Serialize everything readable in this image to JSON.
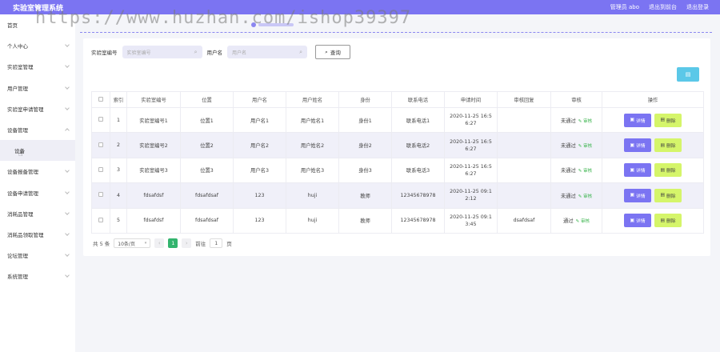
{
  "app": {
    "title": "实验室管理系统",
    "watermark": "https://www.huzhan.com/ishop39397"
  },
  "topbar": {
    "user": "管理员 abo",
    "back_to_front": "退出到前台",
    "logout": "退出登录"
  },
  "sidebar": {
    "items": [
      {
        "label": "首页"
      },
      {
        "label": "个人中心"
      },
      {
        "label": "实验室管理"
      },
      {
        "label": "用户管理"
      },
      {
        "label": "实验室申请管理"
      },
      {
        "label": "设备管理"
      },
      {
        "label": "设备"
      },
      {
        "label": "设备报备管理"
      },
      {
        "label": "设备申请管理"
      },
      {
        "label": "消耗品管理"
      },
      {
        "label": "消耗品领取管理"
      },
      {
        "label": "论坛管理"
      },
      {
        "label": "系统管理"
      }
    ]
  },
  "search": {
    "lab_no_label": "实验室编号",
    "lab_no_placeholder": "实验室编号",
    "username_label": "用户名",
    "username_placeholder": "用户名",
    "query_button": "查询"
  },
  "table": {
    "headers": [
      "",
      "索引",
      "实验室编号",
      "位置",
      "用户名",
      "用户姓名",
      "身份",
      "联系电话",
      "申请时间",
      "审核回复",
      "审核",
      "操作"
    ],
    "rows": [
      {
        "index": "1",
        "lab_no": "实验室编号1",
        "location": "位置1",
        "username": "用户名1",
        "realname": "用户姓名1",
        "identity": "身份1",
        "phone": "联系电话1",
        "time": "2020-11-25 16:5 6:27",
        "reply": "",
        "status": "未通过",
        "audit": "审核",
        "detail": "详情",
        "delete": "删除"
      },
      {
        "index": "2",
        "lab_no": "实验室编号2",
        "location": "位置2",
        "username": "用户名2",
        "realname": "用户姓名2",
        "identity": "身份2",
        "phone": "联系电话2",
        "time": "2020-11-25 16:5 6:27",
        "reply": "",
        "status": "未通过",
        "audit": "审核",
        "detail": "详情",
        "delete": "删除"
      },
      {
        "index": "3",
        "lab_no": "实验室编号3",
        "location": "位置3",
        "username": "用户名3",
        "realname": "用户姓名3",
        "identity": "身份3",
        "phone": "联系电话3",
        "time": "2020-11-25 16:5 6:27",
        "reply": "",
        "status": "未通过",
        "audit": "审核",
        "detail": "详情",
        "delete": "删除"
      },
      {
        "index": "4",
        "lab_no": "fdsafdsf",
        "location": "fdsafdsaf",
        "username": "123",
        "realname": "huji",
        "identity": "教师",
        "phone": "12345678978",
        "time": "2020-11-25 09:1 2:12",
        "reply": "",
        "status": "未通过",
        "audit": "审核",
        "detail": "详情",
        "delete": "删除"
      },
      {
        "index": "5",
        "lab_no": "fdsafdsf",
        "location": "fdsafdsaf",
        "username": "123",
        "realname": "huji",
        "identity": "教师",
        "phone": "12345678978",
        "time": "2020-11-25 09:1 3:45",
        "reply": "dsafdsaf",
        "status": "通过",
        "audit": "审核",
        "detail": "详情",
        "delete": "删除"
      }
    ]
  },
  "pager": {
    "total": "共 5 条",
    "page_size": "10条/页",
    "current": "1",
    "goto_label": "前往",
    "goto_value": "1",
    "page_suffix": "页"
  },
  "colors": {
    "accent": "#7b74f2",
    "delete_btn": "#d5f56a",
    "batch_btn": "#5bc8e8",
    "page_active": "#33b46e"
  }
}
